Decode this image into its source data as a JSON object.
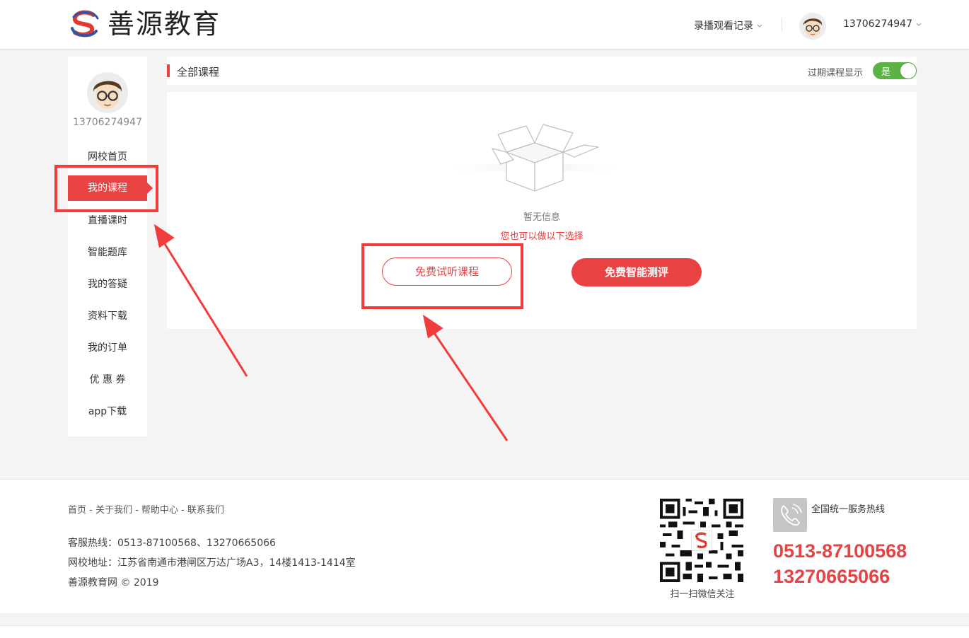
{
  "brand": {
    "name": "善源教育",
    "logo_icon": "brand-s-logo-icon",
    "colors": {
      "accent": "#e84242",
      "toggle_on": "#5bb345",
      "logo_red": "#e33a2f",
      "logo_blue": "#2b55a6"
    }
  },
  "header": {
    "record_link": "录播观看记录",
    "username": "13706274947"
  },
  "sidebar": {
    "username": "13706274947",
    "items": [
      {
        "label": "网校首页",
        "active": false
      },
      {
        "label": "我的课程",
        "active": true
      },
      {
        "label": "直播课时",
        "active": false
      },
      {
        "label": "智能题库",
        "active": false
      },
      {
        "label": "我的答疑",
        "active": false
      },
      {
        "label": "资料下载",
        "active": false
      },
      {
        "label": "我的订单",
        "active": false
      },
      {
        "label": "优 惠 券",
        "active": false
      },
      {
        "label": "app下载",
        "active": false
      }
    ]
  },
  "content": {
    "title": "全部课程",
    "toggle_label": "过期课程显示",
    "toggle_value": "是",
    "empty_text": "暂无信息",
    "empty_sub": "您也可以做以下选择",
    "free_trial_button": "免费试听课程",
    "free_eval_button": "免费智能测评"
  },
  "footer": {
    "links": "首页 - 关于我们 - 帮助中心 - 联系我们",
    "service_hotline": "客服热线：0513-87100568、13270665066",
    "address": "网校地址：江苏省南通市港闸区万达广场A3，14楼1413-1414室",
    "copyright": "善源教育网 © 2019",
    "qr_caption": "扫一扫微信关注",
    "hotline_label": "全国统一服务热线",
    "hotline_1": "0513-87100568",
    "hotline_2": "13270665066"
  }
}
